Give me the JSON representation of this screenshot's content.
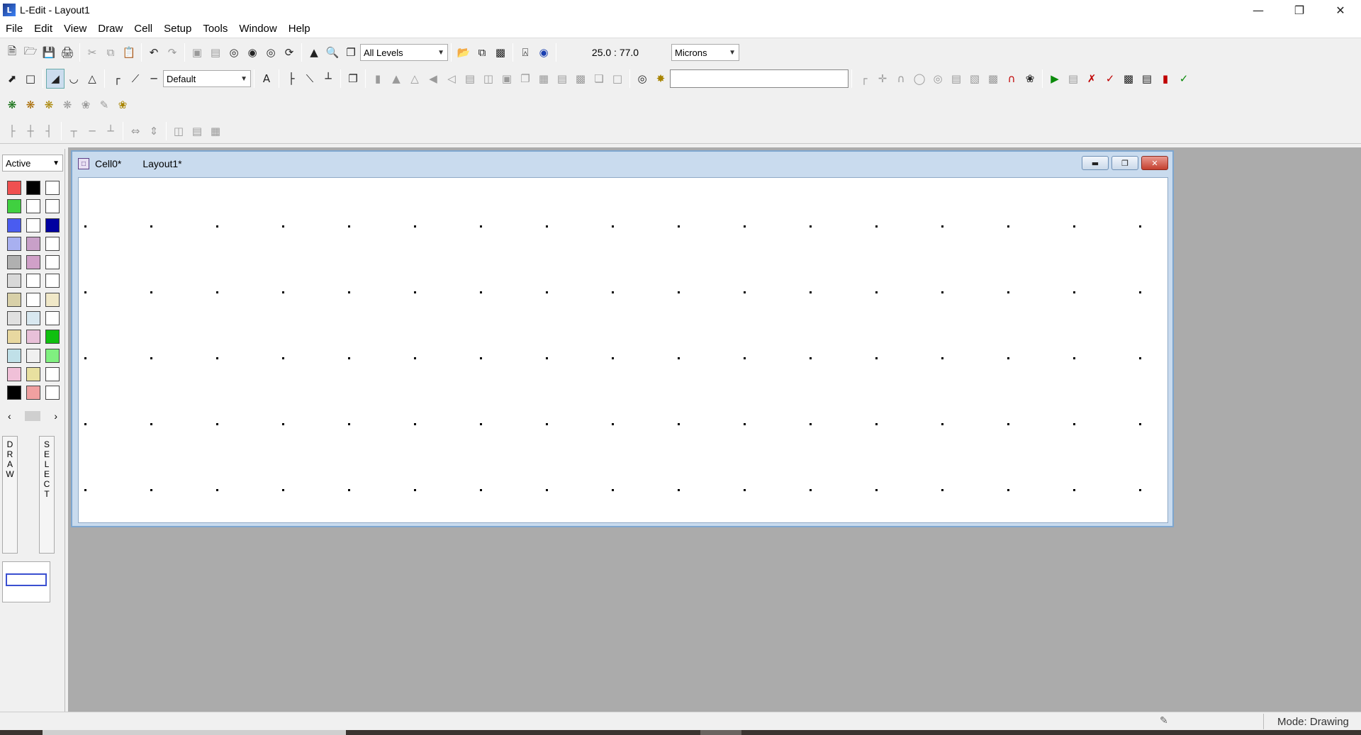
{
  "window": {
    "title": "L-Edit - Layout1",
    "app_icon": "ledit-app-icon"
  },
  "menu": [
    "File",
    "Edit",
    "View",
    "Draw",
    "Cell",
    "Setup",
    "Tools",
    "Window",
    "Help"
  ],
  "toolbar1": {
    "levels_select": "All Levels",
    "zoom_ratio": "25.0 : 77.0",
    "units_select": "Microns"
  },
  "toolbar2": {
    "style_select": "Default",
    "search_value": ""
  },
  "layer_panel": {
    "filter_select": "Active",
    "swatch_colors": [
      "#f05050",
      "#000000",
      "#ffffff",
      "#40d040",
      "#ffffff",
      "#ffffff",
      "#4a5cf0",
      "#ffffff",
      "#0000a0",
      "#a8b0f0",
      "#c8a0c8",
      "#ffffff",
      "#b0b0b0",
      "#d0a0c8",
      "#ffffff",
      "#d8d8d8",
      "#ffffff",
      "#ffffff",
      "#d8d0a8",
      "#ffffff",
      "#f0e8c8",
      "#e0e0e0",
      "#d8e8f0",
      "#ffffff",
      "#e8d8a0",
      "#e8c0d8",
      "#10c010",
      "#c0e0e8",
      "#f0f0f0",
      "#80f080",
      "#f0c0d8",
      "#e8e0a0",
      "#ffffff",
      "#000000",
      "#f0a0a0",
      "#ffffff"
    ],
    "draw_tab": [
      "D",
      "R",
      "A",
      "W"
    ],
    "select_tab": [
      "S",
      "E",
      "L",
      "E",
      "C",
      "T"
    ]
  },
  "cell_window": {
    "cell_tab": "Cell0*",
    "layout_tab": "Layout1*"
  },
  "status": {
    "mode": "Mode: Drawing"
  }
}
